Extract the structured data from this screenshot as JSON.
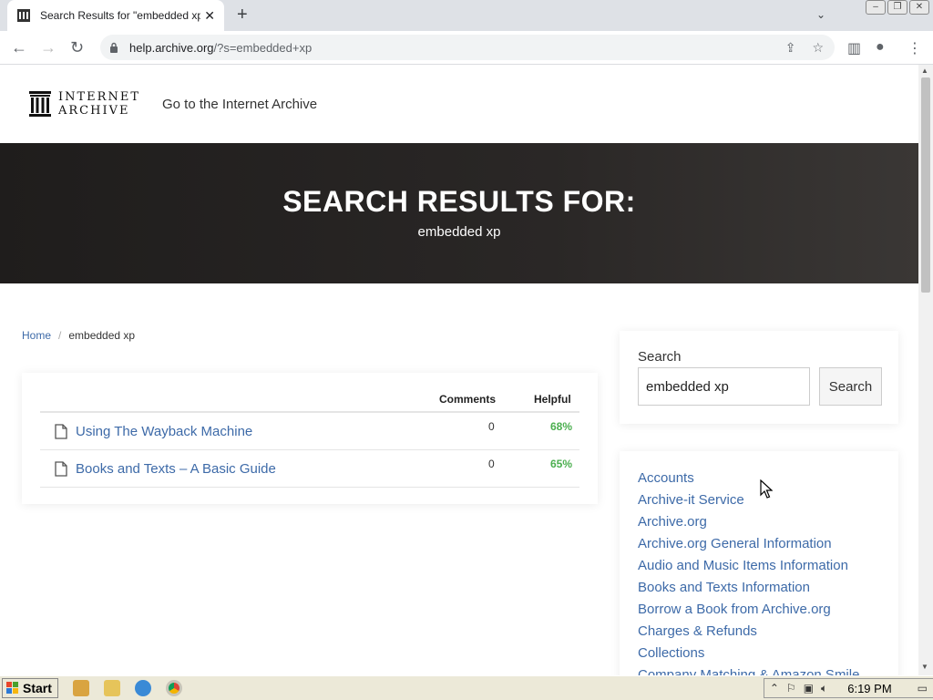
{
  "browser": {
    "tab_title": "Search Results for \"embedded xp",
    "url_host": "help.archive.org",
    "url_path": "/?s=embedded+xp"
  },
  "header": {
    "logo_line1": "INTERNET",
    "logo_line2": "ARCHIVE",
    "go_link": "Go to the Internet Archive"
  },
  "hero": {
    "title": "SEARCH RESULTS FOR:",
    "query": "embedded xp"
  },
  "breadcrumb": {
    "home": "Home",
    "sep": "/",
    "current": "embedded xp"
  },
  "results": {
    "col_comments": "Comments",
    "col_helpful": "Helpful",
    "rows": [
      {
        "title": "Using The Wayback Machine",
        "comments": "0",
        "helpful": "68%"
      },
      {
        "title": "Books and Texts – A Basic Guide",
        "comments": "0",
        "helpful": "65%"
      }
    ]
  },
  "search_widget": {
    "label": "Search",
    "value": "embedded xp",
    "button": "Search"
  },
  "categories": [
    "Accounts",
    "Archive-it Service",
    "Archive.org",
    "Archive.org General Information",
    "Audio and Music Items Information",
    "Books and Texts Information",
    "Borrow a Book from Archive.org",
    "Charges & Refunds",
    "Collections",
    "Company Matching & Amazon Smile"
  ],
  "taskbar": {
    "start": "Start",
    "clock": "6:19 PM"
  },
  "colors": {
    "link": "#3d6aa8",
    "helpful": "#4caf50",
    "hero_bg": "#242120"
  }
}
